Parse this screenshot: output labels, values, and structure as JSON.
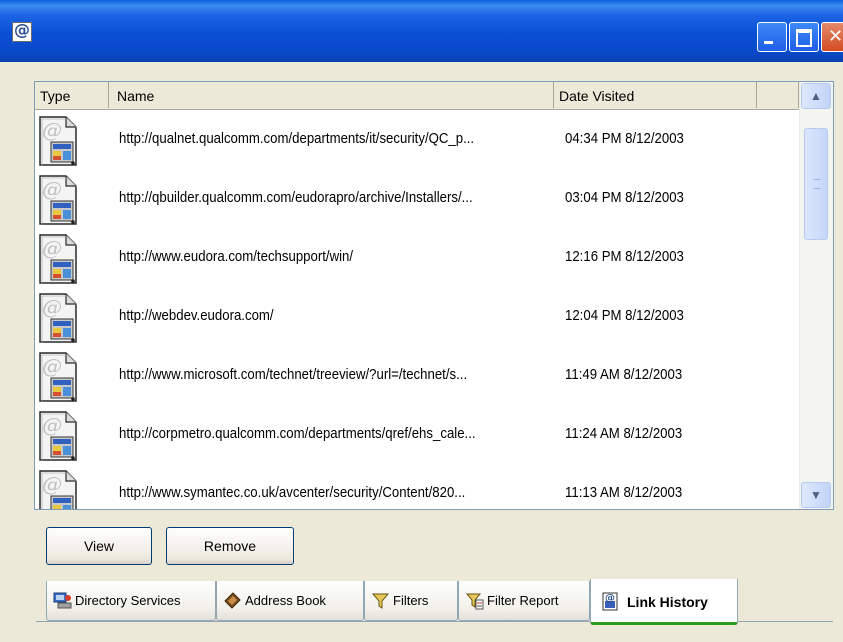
{
  "window": {
    "icon": "eudora-at-icon",
    "controls": [
      "minimize",
      "maximize",
      "close"
    ]
  },
  "columns": {
    "type": "Type",
    "name": "Name",
    "date": "Date Visited"
  },
  "rows": [
    {
      "icon": "link-document-icon",
      "url": "http://qualnet.qualcomm.com/departments/it/security/QC_p...",
      "date": "04:34 PM 8/12/2003"
    },
    {
      "icon": "link-document-icon",
      "url": "http://qbuilder.qualcomm.com/eudorapro/archive/Installers/...",
      "date": "03:04 PM 8/12/2003"
    },
    {
      "icon": "link-document-icon",
      "url": "http://www.eudora.com/techsupport/win/",
      "date": "12:16 PM 8/12/2003"
    },
    {
      "icon": "link-document-icon",
      "url": "http://webdev.eudora.com/",
      "date": "12:04 PM 8/12/2003"
    },
    {
      "icon": "link-document-icon",
      "url": "http://www.microsoft.com/technet/treeview/?url=/technet/s...",
      "date": "11:49 AM 8/12/2003"
    },
    {
      "icon": "link-document-icon",
      "url": "http://corpmetro.qualcomm.com/departments/qref/ehs_cale...",
      "date": "11:24 AM 8/12/2003"
    },
    {
      "icon": "link-document-icon",
      "url": "http://www.symantec.co.uk/avcenter/security/Content/820...",
      "date": "11:13 AM 8/12/2003"
    }
  ],
  "buttons": {
    "view": "View",
    "remove": "Remove"
  },
  "tabs": [
    {
      "label": "Directory Services",
      "icon": "directory-services-icon"
    },
    {
      "label": "Address Book",
      "icon": "address-book-icon"
    },
    {
      "label": "Filters",
      "icon": "filters-icon"
    },
    {
      "label": "Filter Report",
      "icon": "filter-report-icon"
    },
    {
      "label": "Link History",
      "icon": "link-history-icon",
      "active": true
    }
  ],
  "colors": {
    "titlebar": "#0a4fd3",
    "window_bg": "#ece9d8",
    "active_tab_accent": "#2c9c1e"
  }
}
